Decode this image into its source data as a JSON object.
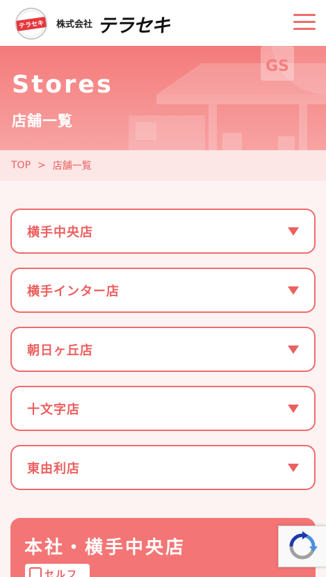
{
  "header": {
    "logo_seal_text": "テラセキ",
    "company_prefix": "株式会社",
    "company_brand": "テラセキ"
  },
  "hero": {
    "title": "Stores",
    "subtitle": "店舗一覧",
    "sign_text": "GS"
  },
  "breadcrumb": {
    "home": "TOP",
    "separator": ">",
    "current": "店舗一覧"
  },
  "stores": [
    {
      "name": "横手中央店"
    },
    {
      "name": "横手インター店"
    },
    {
      "name": "朝日ヶ丘店"
    },
    {
      "name": "十文字店"
    },
    {
      "name": "東由利店"
    }
  ],
  "hq": {
    "title": "本社・横手中央店",
    "badge_label": "セルフ"
  },
  "colors": {
    "accent": "#ec5f5f",
    "hero_top": "#f47a7a",
    "breadcrumb_bg": "#fde6e6",
    "page_bg": "#fdf3f3"
  },
  "icons": {
    "menu": "hamburger-icon",
    "store_toggle": "chevron-down-icon",
    "badge": "self-service-icon",
    "recaptcha": "recaptcha-icon"
  }
}
